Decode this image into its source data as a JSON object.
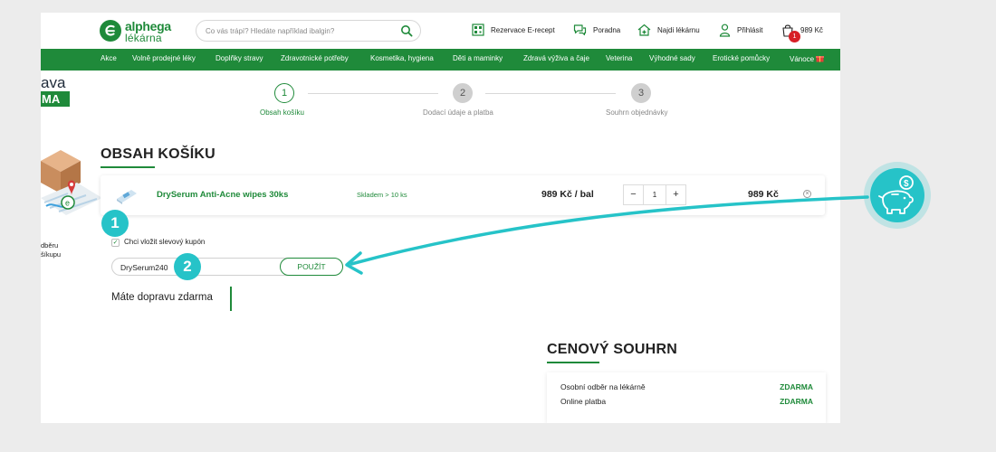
{
  "header": {
    "logo": {
      "top": "alphega",
      "bottom": "lékárna"
    },
    "search": {
      "placeholder": "Co vás trápí? Hledáte například ibalgin?"
    },
    "links": [
      {
        "label": "Rezervace E-recept",
        "icon": "qr-code-icon"
      },
      {
        "label": "Poradna",
        "icon": "chat-icon"
      },
      {
        "label": "Najdi lékárnu",
        "icon": "pharmacy-house-icon"
      },
      {
        "label": "Přihlásit",
        "icon": "user-icon"
      }
    ],
    "cart": {
      "amount": "989 Kč",
      "badge": "1",
      "icon": "cart-bag-icon"
    }
  },
  "nav": {
    "items": [
      "Akce",
      "Volně prodejné léky",
      "Doplňky stravy",
      "Zdravotnické potřeby",
      "Kosmetika, hygiena",
      "Děti a maminky",
      "Zdravá výživa a čaje",
      "Veterina",
      "Výhodné sady",
      "Erotické pomůcky",
      "Vánoce"
    ]
  },
  "banner": {
    "line1": "ava",
    "tag": "MA",
    "caption1": "dběru",
    "caption2": "šíkupu"
  },
  "steps": [
    {
      "number": "1",
      "label": "Obsah košíku",
      "state": "active"
    },
    {
      "number": "2",
      "label": "Dodací údaje a platba",
      "state": "inactive"
    },
    {
      "number": "3",
      "label": "Souhrn objednávky",
      "state": "inactive"
    }
  ],
  "cart": {
    "title": "OBSAH KOŠÍKU",
    "item": {
      "name": "DrySerum Anti-Acne wipes 30ks",
      "stock": "Skladem > 10 ks",
      "unit_price": "989  Kč / bal",
      "qty_minus": "−",
      "quantity": "1",
      "qty_plus": "+",
      "total": "989  Kč",
      "remove": "×"
    },
    "coupon": {
      "checkbox_label": "Chci vložit slevový kupón",
      "checked": true,
      "check_mark": "✓",
      "value": "DrySerum240",
      "apply_label": "POUŽÍT"
    },
    "free_shipping": "Máte dopravu zdarma"
  },
  "summary": {
    "title": "CENOVÝ SOUHRN",
    "rows": [
      {
        "label": "Osobní odběr na lékárně",
        "value": "ZDARMA"
      },
      {
        "label": "Online platba",
        "value": "ZDARMA"
      }
    ]
  },
  "annotations": {
    "callout1": "1",
    "callout2": "2",
    "accent_color": "#26c3c8",
    "piggy_icon": "piggy-bank-coin-icon"
  },
  "colors": {
    "brand_green": "#1f8a3a",
    "badge_red": "#d71f26",
    "teal": "#26c3c8"
  }
}
